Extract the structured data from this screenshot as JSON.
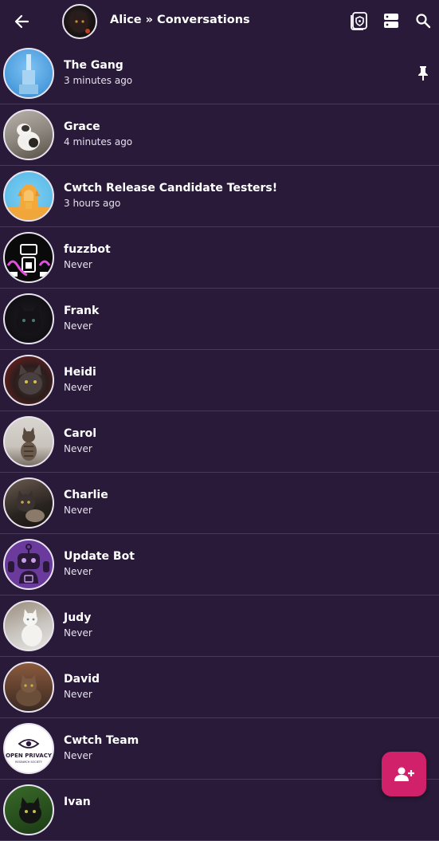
{
  "header": {
    "title": "Alice » Conversations",
    "icons": [
      "back-arrow-icon",
      "profile-avatar",
      "shield-lock-icon",
      "server-icon",
      "search-icon"
    ]
  },
  "conversations": [
    {
      "name": "The Gang",
      "time": "3 minutes ago",
      "pinned": true
    },
    {
      "name": "Grace",
      "time": "4 minutes ago"
    },
    {
      "name": "Cwtch Release Candidate Testers!",
      "time": "3 hours ago"
    },
    {
      "name": "fuzzbot",
      "time": "Never"
    },
    {
      "name": "Frank",
      "time": "Never"
    },
    {
      "name": "Heidi",
      "time": "Never"
    },
    {
      "name": "Carol",
      "time": "Never"
    },
    {
      "name": "Charlie",
      "time": "Never"
    },
    {
      "name": "Update Bot",
      "time": "Never"
    },
    {
      "name": "Judy",
      "time": "Never"
    },
    {
      "name": "David",
      "time": "Never"
    },
    {
      "name": "Cwtch Team",
      "time": "Never",
      "avatar_text": "OPEN PRIVACY",
      "avatar_subtext": "RESEARCH SOCIETY"
    },
    {
      "name": "Ivan",
      "time": ""
    }
  ],
  "fab": {
    "icon": "add-contact-icon"
  },
  "colors": {
    "background": "#281a38",
    "divider": "#4a3a5a",
    "accent": "#d2216b",
    "text": "#ffffff"
  }
}
